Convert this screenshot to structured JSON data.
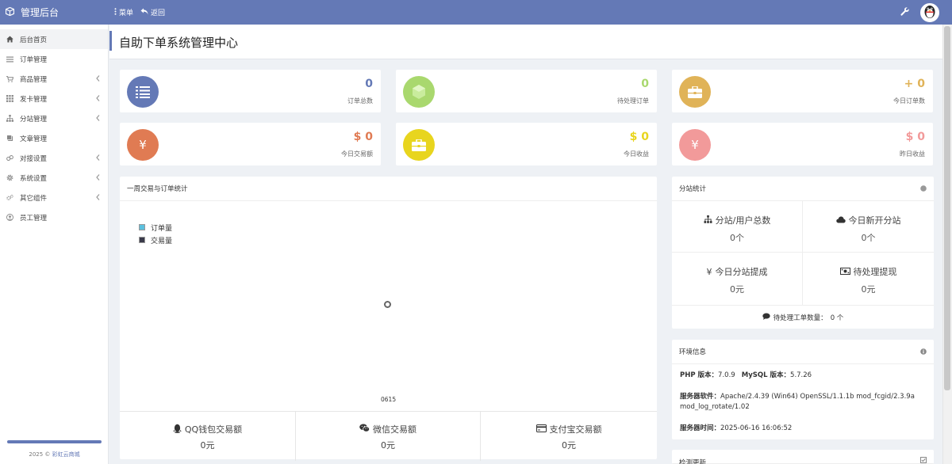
{
  "app": {
    "title": "管理后台"
  },
  "topnav": {
    "menu_label": "菜单",
    "back_label": "返回"
  },
  "sidebar": {
    "items": [
      {
        "label": "后台首页",
        "icon": "home-icon"
      },
      {
        "label": "订单管理",
        "icon": "list-icon"
      },
      {
        "label": "商品管理",
        "icon": "cart-icon"
      },
      {
        "label": "发卡管理",
        "icon": "grid-icon"
      },
      {
        "label": "分站管理",
        "icon": "sitemap-icon"
      },
      {
        "label": "文章管理",
        "icon": "book-icon"
      },
      {
        "label": "对接设置",
        "icon": "link-icon"
      },
      {
        "label": "系统设置",
        "icon": "gear-icon"
      },
      {
        "label": "其它组件",
        "icon": "cogs-icon"
      },
      {
        "label": "员工管理",
        "icon": "user-icon"
      }
    ],
    "copyright_prefix": "2025 © ",
    "copyright_link": "彩虹云商城"
  },
  "page": {
    "title": "自助下单系统管理中心"
  },
  "stats": [
    {
      "value": "0",
      "label": "订单总数",
      "color": "#6479b6",
      "value_color": "#6479b6",
      "icon": "list-icon"
    },
    {
      "value": "0",
      "label": "待处理订单",
      "color": "#a9d86e",
      "value_color": "#a9d86e",
      "icon": "cube-icon"
    },
    {
      "value": "+ 0",
      "label": "今日订单数",
      "color": "#e0b358",
      "value_color": "#e0b358",
      "icon": "briefcase-icon"
    },
    {
      "value": "$ 0",
      "label": "今日交易额",
      "color": "#e07b53",
      "value_color": "#e07b53",
      "icon": "yen-icon",
      "glyph": "¥"
    },
    {
      "value": "$ 0",
      "label": "今日收益",
      "color": "#e8d51e",
      "value_color": "#e8d51e",
      "icon": "briefcase-icon"
    },
    {
      "value": "$ 0",
      "label": "昨日收益",
      "color": "#f29a9a",
      "value_color": "#f29a9a",
      "icon": "yen-icon",
      "glyph": "¥"
    }
  ],
  "chart_panel": {
    "title": "一周交易与订单统计",
    "legend": [
      {
        "name": "订单量",
        "color": "#5bc0de"
      },
      {
        "name": "交易量",
        "color": "#3a3a4a"
      }
    ],
    "payments": [
      {
        "label": "QQ钱包交易额",
        "value": "0元",
        "icon": "qq-icon"
      },
      {
        "label": "微信交易额",
        "value": "0元",
        "icon": "wechat-icon"
      },
      {
        "label": "支付宝交易额",
        "value": "0元",
        "icon": "credit-card-icon"
      }
    ]
  },
  "chart_data": {
    "type": "line",
    "title": "",
    "categories": [
      "0615"
    ],
    "series": [
      {
        "name": "订单量",
        "values": []
      },
      {
        "name": "交易量",
        "values": []
      }
    ],
    "xlabel": "",
    "ylabel": "",
    "legend_position": "top-left"
  },
  "substation": {
    "title": "分站统计",
    "cells": [
      {
        "label": "分站/用户总数",
        "value": "0个",
        "icon": "sitemap-icon"
      },
      {
        "label": "今日新开分站",
        "value": "0个",
        "icon": "cloud-icon"
      },
      {
        "label": "今日分站提成",
        "value": "0元",
        "icon": "yen-icon"
      },
      {
        "label": "待处理提现",
        "value": "0元",
        "icon": "money-icon"
      }
    ],
    "ticket_label": "待处理工单数量：",
    "ticket_value": "0 个"
  },
  "env": {
    "title": "环境信息",
    "php_label": "PHP 版本：",
    "php_value": "7.0.9",
    "mysql_label": "MySQL 版本：",
    "mysql_value": "5.7.26",
    "software_label": "服务器软件：",
    "software_value": "Apache/2.4.39 (Win64) OpenSSL/1.1.1b mod_fcgid/2.3.9a mod_log_rotate/1.02",
    "time_label": "服务器时间：",
    "time_value": "2025-06-16 16:06:52"
  },
  "update_panel": {
    "title": "检测更新"
  }
}
